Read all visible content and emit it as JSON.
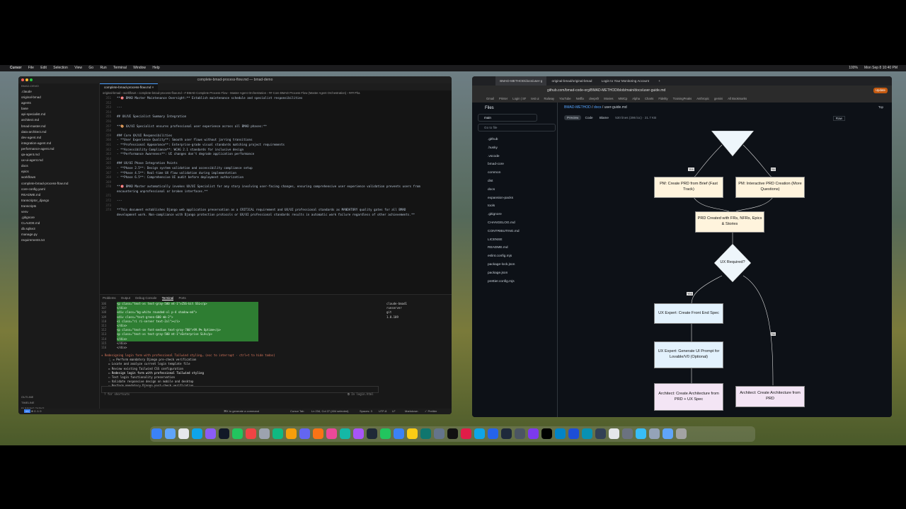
{
  "menubar": {
    "items": [
      "Cursor",
      "File",
      "Edit",
      "Selection",
      "View",
      "Go",
      "Run",
      "Terminal",
      "Window",
      "Help"
    ],
    "clock": "Mon Sep 8 10:40 PM",
    "battery": "100%"
  },
  "cursor": {
    "window_title": "complete-bmad-process-flow.md — bmad-demo",
    "explorer_root": "BMAD-DEMO",
    "tree": [
      ".claude",
      "original-bmad",
      "agents",
      "base",
      "api-specialist.md",
      "architect.md",
      "bmad-master.md",
      "data-architect.md",
      "dev-agent.md",
      "integration-agent.md",
      "performance-agent.md",
      "qa-agent.md",
      "ux-ui-agent.md",
      "docs",
      "epics",
      "workflows",
      "complete-bmad-process-flow.md",
      "core-config.yaml",
      "README.md",
      "transcriptor_django",
      "transcripts",
      "venv",
      ".gitignore",
      "CLAUDE.md",
      "db.sqlite3",
      "manage.py",
      "requirements.txt"
    ],
    "bottom_sections": [
      "OUTLINE",
      "TIMELINE",
      "RUNNING TASKS"
    ],
    "tab": "complete-bmad-process-flow.md",
    "breadcrumb": "original-bmad › workflows › complete-bmad-process-flow.md › # BMAD Complete Process Flow - Master Agent Orchestration › ## Core BMAD Process Flow (Master Agent Orchestration) › ### Pha",
    "code_lines": [
      {
        "n": "351",
        "t": "**🎯 BMAD Master Maintenance Oversight:** Establish maintenance schedule and specialist responsibilities"
      },
      {
        "n": "352",
        "t": ""
      },
      {
        "n": "353",
        "t": "---"
      },
      {
        "n": "354",
        "t": ""
      },
      {
        "n": "355",
        "t": "## UX/UI Specialist Summary Integration"
      },
      {
        "n": "356",
        "t": ""
      },
      {
        "n": "357",
        "t": "**🎨 UX/UI Specialist ensures professional user experience across all BMAD phases:**"
      },
      {
        "n": "358",
        "t": ""
      },
      {
        "n": "359",
        "t": "### Core UX/UI Responsibilities"
      },
      {
        "n": "360",
        "t": "- **User Experience Quality**: Smooth user flows without jarring transitions"
      },
      {
        "n": "361",
        "t": "- **Professional Appearance**: Enterprise-grade visual standards matching project requirements"
      },
      {
        "n": "362",
        "t": "- **Accessibility Compliance**: WCAG 2.1 standards for inclusive design"
      },
      {
        "n": "363",
        "t": "- **Performance Awareness**: UI changes don't degrade application performance"
      },
      {
        "n": "364",
        "t": ""
      },
      {
        "n": "365",
        "t": "### UX/UI Phase Integration Points"
      },
      {
        "n": "366",
        "t": "- **Phase 2.5**: Design system validation and accessibility compliance setup"
      },
      {
        "n": "367",
        "t": "- **Phase 4.5**: Real-time UX flow validation during implementation"
      },
      {
        "n": "368",
        "t": "- **Phase 6.5**: Comprehensive UI audit before deployment authorization"
      },
      {
        "n": "369",
        "t": ""
      },
      {
        "n": "370",
        "t": "**🎯 BMAD Master automatically invokes UX/UI Specialist for any story involving user-facing changes, ensuring comprehensive user experience validation prevents users from"
      },
      {
        "n": "",
        "t": "encountering unprofessional or broken interfaces.**"
      },
      {
        "n": "371",
        "t": ""
      },
      {
        "n": "372",
        "t": "---"
      },
      {
        "n": "373",
        "t": ""
      },
      {
        "n": "374",
        "t": "**This document establishes Django web application preservation as a CRITICAL requirement and UX/UI professional standards as MANDATORY quality gates for all BMAD"
      },
      {
        "n": "",
        "t": "development work. Non-compliance with Django protection protocols or UX/UI professional standards results in automatic work failure regardless of other achievements.**"
      }
    ],
    "panel_tabs": [
      "Problems",
      "Output",
      "Debug Console",
      "Terminal",
      "Ports"
    ],
    "terminal_lines": [
      {
        "n": "106",
        "t": "<p class=\"text-xs text-gray-500 mt-1\">256-bit SSL</p>",
        "hl": true
      },
      {
        "n": "107",
        "t": "</div>",
        "hl": true
      },
      {
        "n": "108",
        "t": "<div class=\"bg-white rounded-xl p-4 shadow-md\">",
        "hl": true
      },
      {
        "n": "109",
        "t": "<div class=\"text-green-600 mb-2\">",
        "hl": true
      },
      {
        "n": "110",
        "t": "<i class=\"ri ri-server text-2xl\"></i>",
        "hl": true
      },
      {
        "n": "111",
        "t": "</div>",
        "hl": true
      },
      {
        "n": "112",
        "t": "<p class=\"text-sm font-medium text-gray-700\">99.9% Uptime</p>",
        "hl": true
      },
      {
        "n": "113",
        "t": "<p class=\"text-xs text-gray-500 mt-1\">Enterprise SLA</p>",
        "hl": true
      },
      {
        "n": "114",
        "t": "</div>",
        "hl": true
      },
      {
        "n": "115",
        "t": "</div>",
        "hl": false
      },
      {
        "n": "116",
        "t": "</div>",
        "hl": false
      }
    ],
    "task_status": "✶ Redesigning login form with professional Tailwind styling… (esc to interrupt · ctrl+t to hide todos)",
    "todos": [
      "⎿ ☒ Perform mandatory Django pre-check verification",
      "☒ Locate and analyze current login template file",
      "☒ Review existing Tailwind CSS configuration",
      "☐ Redesign login form with professional Tailwind styling",
      "☐ Test login functionality preservation",
      "☐ Validate responsive design on mobile and desktop",
      "☐ Perform mandatory Django post-check verification"
    ],
    "prompt_hint": "? for shortcuts",
    "prompt_right": "⧉ In login.html",
    "terminal_list": [
      "claude-bmad1",
      "runserver",
      "git",
      "1.0.109"
    ],
    "status": {
      "left": "⊗ 0 ⚠ 0",
      "center": "⌘K to generate a command",
      "cursor_tab": "Cursor Tab",
      "position": "Ln 234, Col 27 (404 selected)",
      "spaces": "Spaces: 3",
      "encoding": "UTF-8",
      "eol": "LF",
      "lang": "Markdown",
      "fmt": "✓ Prettier"
    }
  },
  "browser": {
    "tabs": [
      "BMAD-METHOD/docs/user-g",
      "original-bmad/original-bmad",
      "Login to Your Monitoring Account"
    ],
    "url": "github.com/bmad-code-org/BMAD-METHOD/blob/main/docs/user-guide.md",
    "update_label": "Update",
    "bookmarks": [
      "Gmail",
      "Printer",
      "Login | SF",
      "test ui",
      "Railway",
      "YouTube",
      "Netflix",
      "deepsfr",
      "Movies",
      "MWCp",
      "Alpha",
      "Charts",
      "Fidelity",
      "TrainingPeaks",
      "Anthropic",
      "gemini",
      "All Bookmarks"
    ],
    "files_title": "Files",
    "branch": "main",
    "go_to_file": "Go to file",
    "files": [
      ".github",
      ".husky",
      ".vscode",
      "bmad-core",
      "common",
      "dist",
      "docs",
      "expansion-packs",
      "tools",
      ".gitignore",
      "CHANGELOG.md",
      "CONTRIBUTING.md",
      "LICENSE",
      "README.md",
      "eslint.config.mjs",
      "package-lock.json",
      "package.json",
      "prettier.config.mjs"
    ],
    "repo_crumb": {
      "repo": "BMAD-METHOD",
      "dir": "docs",
      "file": "user-guide.md"
    },
    "top_label": "Top",
    "view_tabs": [
      "Preview",
      "Code",
      "Blame"
    ],
    "file_meta": "530 lines (396 loc) · 21.7 KB",
    "raw_label": "Raw",
    "flow": {
      "yes1": "Yes",
      "no1": "No",
      "pm_fast": "PM: Create PRD from Brief (Fast Track)",
      "pm_interactive": "PM: Interactive PRD Creation (More Questions)",
      "prd_created": "PRD Created with FRs, NFRs, Epics & Stories",
      "ux_required": "UX Required?",
      "yes2": "Yes",
      "no2": "No",
      "ux_front": "UX Expert: Create Front End Spec",
      "ux_prompt": "UX Expert: Generate UI Prompt for Lovable/V0 (Optional)",
      "arch_prd_ux": "Architect: Create Architecture from PRD + UX Spec",
      "arch_prd": "Architect: Create Architecture from PRD"
    }
  }
}
